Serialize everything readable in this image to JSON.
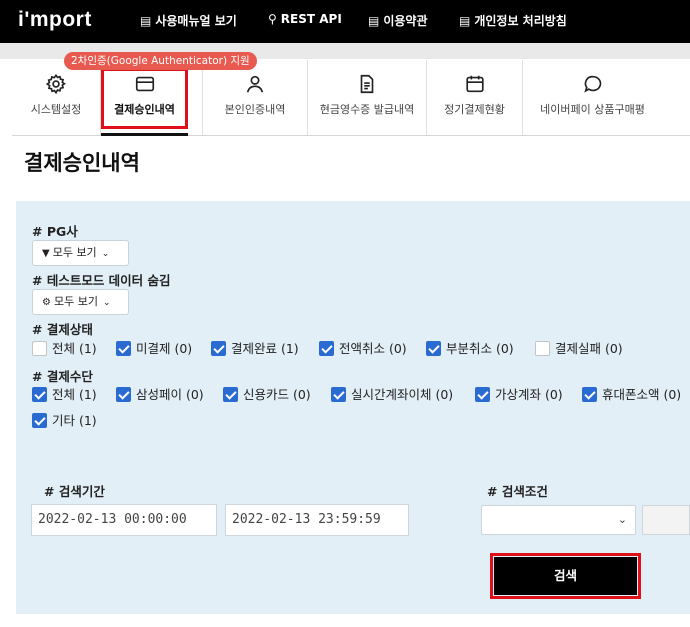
{
  "brand": "i'mport",
  "topnav": [
    {
      "icon": "book-icon",
      "label": "사용매뉴얼 보기"
    },
    {
      "icon": "key-icon",
      "label": "REST API"
    },
    {
      "icon": "book-icon",
      "label": "이용약관"
    },
    {
      "icon": "book-icon",
      "label": "개인정보 처리방침"
    }
  ],
  "tabs": [
    {
      "icon": "gear-icon",
      "label": "시스템설정"
    },
    {
      "icon": "card-icon",
      "label": "결제승인내역"
    },
    {
      "icon": "person-icon",
      "label": "본인인증내역"
    },
    {
      "icon": "document-icon",
      "label": "현금영수증 발급내역"
    },
    {
      "icon": "calendar-icon",
      "label": "정기결제현황"
    },
    {
      "icon": "chat-bubble-icon",
      "label": "네이버페이 상품구매평"
    }
  ],
  "active_tab": "결제승인내역",
  "badge": "2차인증(Google Authenticator) 지원",
  "page_title": "결제승인내역",
  "filters": {
    "pg": {
      "label": "# PG사",
      "value": "모두 보기",
      "icon": "filter-icon"
    },
    "test_mode": {
      "label": "# 테스트모드 데이터 숨김",
      "value": "모두 보기",
      "icon": "gear-icon"
    },
    "status": {
      "label": "# 결제상태",
      "options": [
        {
          "label": "전체 (1)",
          "checked": false
        },
        {
          "label": "미결제 (0)",
          "checked": true
        },
        {
          "label": "결제완료 (1)",
          "checked": true
        },
        {
          "label": "전액취소 (0)",
          "checked": true
        },
        {
          "label": "부분취소 (0)",
          "checked": true
        },
        {
          "label": "결제실패 (0)",
          "checked": false
        }
      ]
    },
    "method": {
      "label": "# 결제수단",
      "options": [
        {
          "label": "전체 (1)",
          "checked": true
        },
        {
          "label": "삼성페이 (0)",
          "checked": true
        },
        {
          "label": "신용카드 (0)",
          "checked": true
        },
        {
          "label": "실시간계좌이체 (0)",
          "checked": true
        },
        {
          "label": "가상계좌 (0)",
          "checked": true
        },
        {
          "label": "휴대폰소액 (0)",
          "checked": true
        },
        {
          "label": "기타 (1)",
          "checked": true
        }
      ]
    }
  },
  "search": {
    "period_label": "# 검색기간",
    "start": "2022-02-13 00:00:00",
    "end": "2022-02-13 23:59:59",
    "condition_label": "# 검색조건",
    "condition_value": "",
    "button": "검색"
  },
  "colors": {
    "accent": "#2a6bd1",
    "highlight": "#e0101a",
    "badge": "#e85a4f",
    "panel": "#e2eff6"
  }
}
